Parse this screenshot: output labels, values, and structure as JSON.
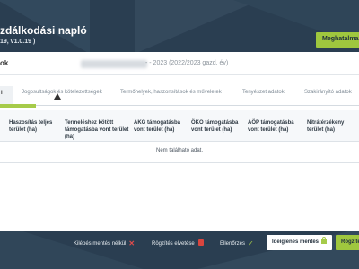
{
  "header": {
    "title": "zdálkodási napló",
    "version": "19, v1.0.19 )",
    "auth_button": "Meghatalmazo"
  },
  "year_row": {
    "label": "ok",
    "value": "- - 2023 (2022/2023 gazd. év)"
  },
  "tabs": [
    {
      "label": "i",
      "active": true
    },
    {
      "label": "Jogosultságok és kötelezettségek",
      "active": false
    },
    {
      "label": "Termőhelyek, haszonsítások és műveletek",
      "active": false
    },
    {
      "label": "Tenyészet adatok",
      "active": false
    },
    {
      "label": "Szakirányító adatok",
      "active": false
    }
  ],
  "table": {
    "columns": [
      "Haszosítás teljes terület (ha)",
      "Termeléshez kötött támogatásba vont terület (ha)",
      "AKG támogatásba vont terület (ha)",
      "ÖKO támogatásba vont terület (ha)",
      "AÖP támogatásba vont terület (ha)",
      "Nitrátérzékeny terület (ha)"
    ],
    "empty_message": "Nem található adat."
  },
  "footer": {
    "exit_label": "Kilépés mentés nélkül",
    "discard_label": "Rögzítés elvetése",
    "check_label": "Ellenőrzés",
    "temp_save_label": "Ideiglenes mentés",
    "save_label": "Rögzítés"
  },
  "icons": [
    "close-icon",
    "trash-icon",
    "check-icon",
    "lock-icon",
    "cursor-icon"
  ],
  "colors": {
    "accent_green": "#9fc73e",
    "backdrop": "#2a3e51",
    "danger": "#d9453e"
  }
}
